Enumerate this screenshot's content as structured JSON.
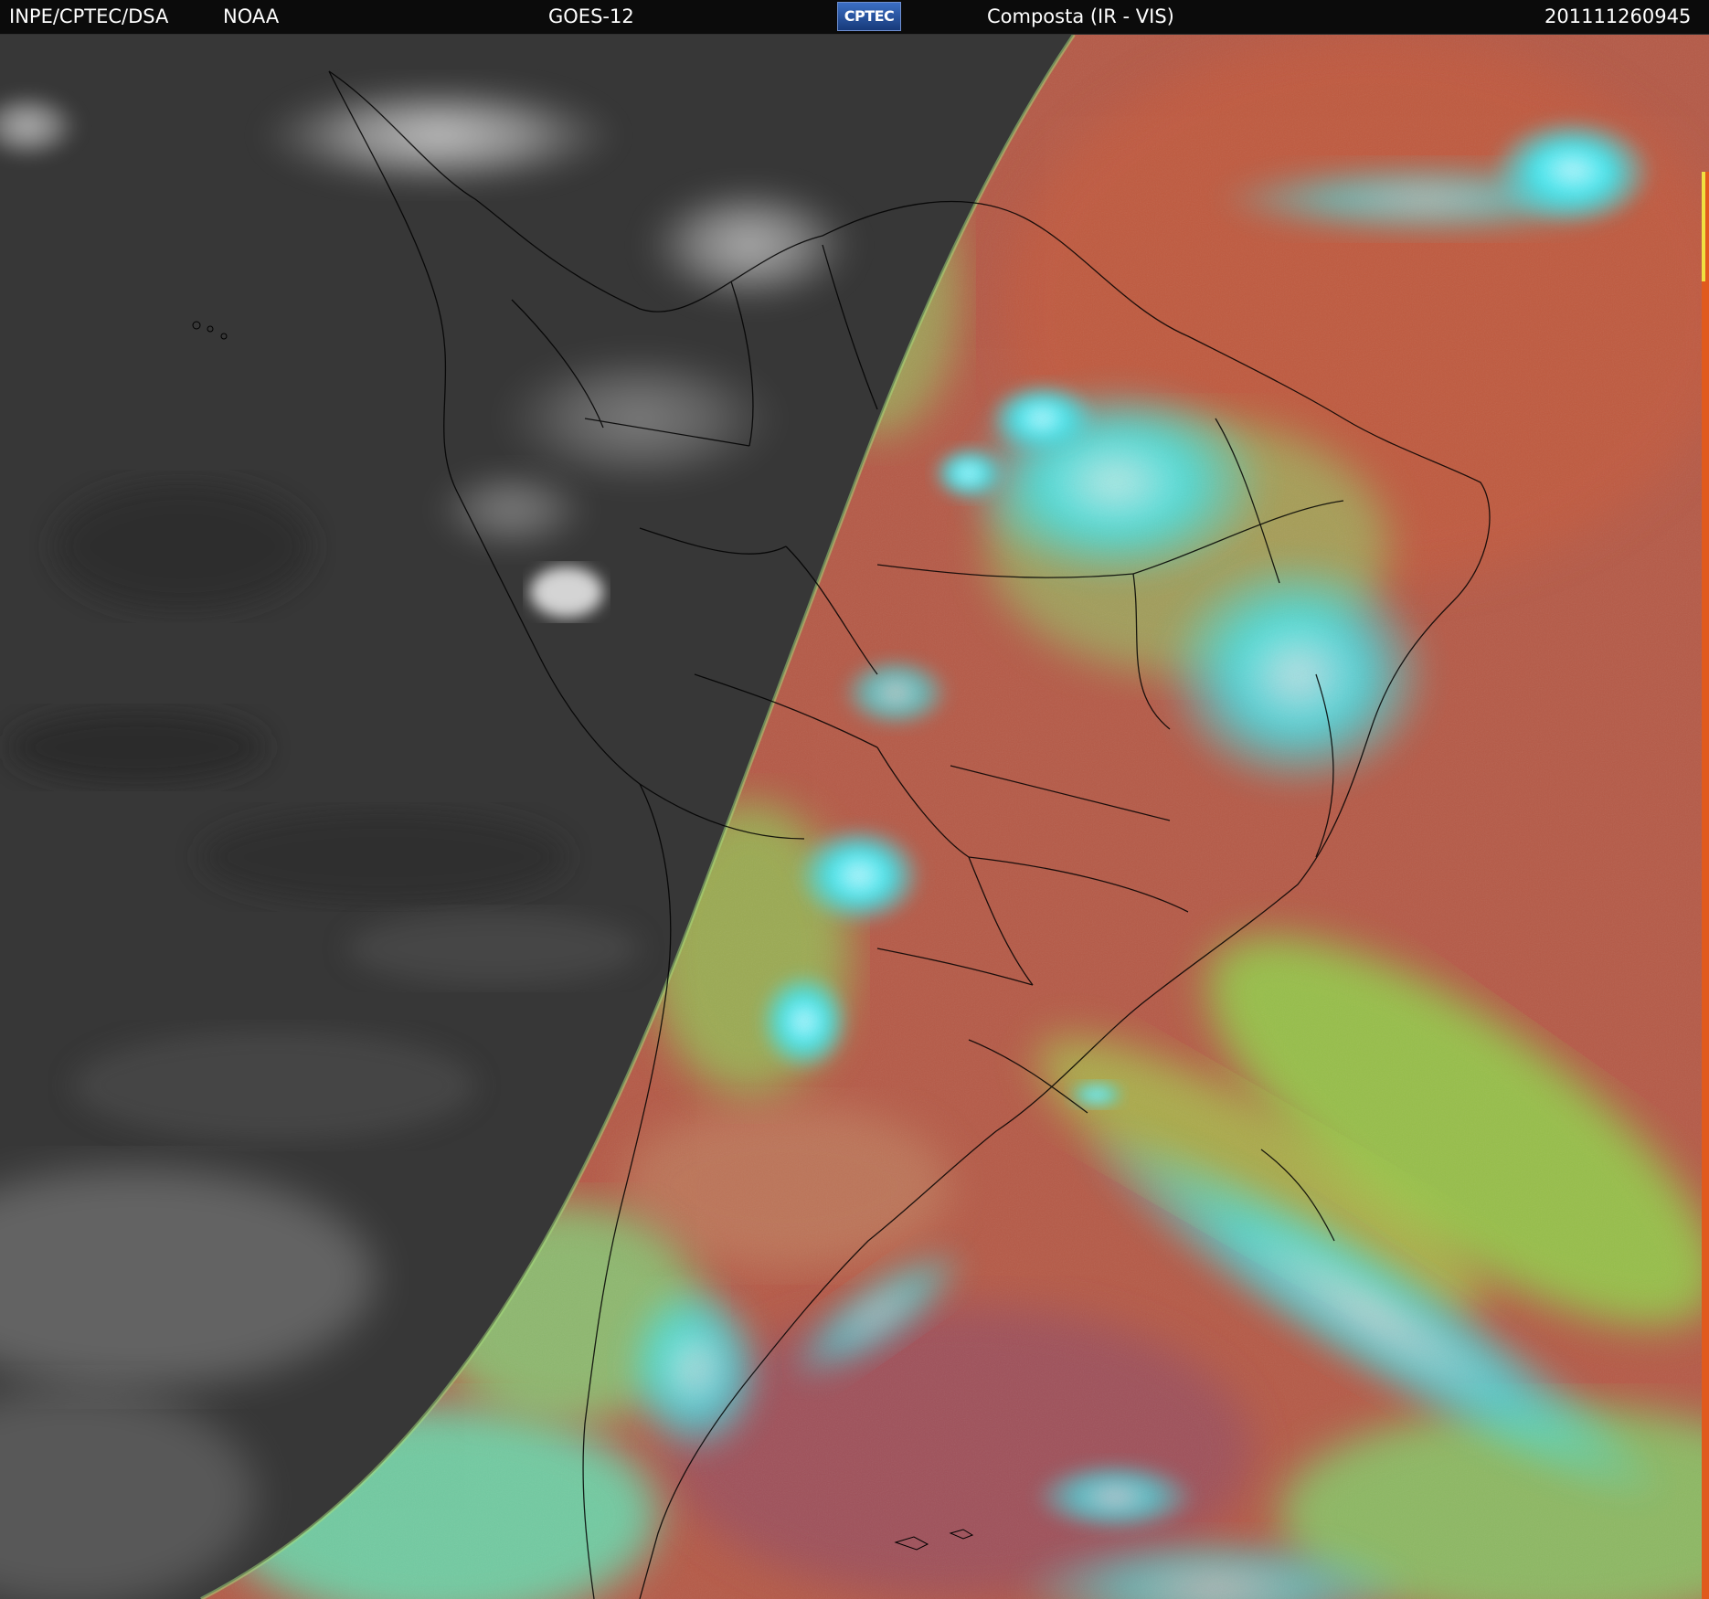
{
  "header": {
    "agency": "INPE/CPTEC/DSA",
    "provider": "NOAA",
    "satellite": "GOES-12",
    "logo_text": "CPTEC",
    "product": "Composta (IR - VIS)",
    "timestamp": "201111260945"
  },
  "colors": {
    "header_bg": "#0b0b0b",
    "night_ir": "#3a3a3a",
    "day_land": "#b85a48",
    "day_cloud_high": "#35e6e6",
    "day_cloud_low": "#8fe05a",
    "border_lines": "#000000"
  },
  "map": {
    "region": "South America",
    "left_half": "IR night grayscale",
    "right_half": "composite day false-color"
  }
}
